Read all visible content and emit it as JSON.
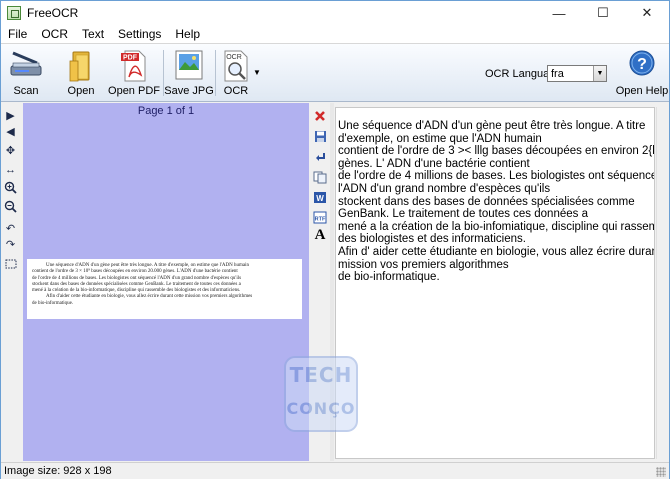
{
  "window": {
    "title": "FreeOCR",
    "controls": {
      "minimize": "—",
      "maximize": "☐",
      "close": "✕"
    }
  },
  "menu": [
    "File",
    "OCR",
    "Text",
    "Settings",
    "Help"
  ],
  "toolbar": {
    "scan_label": "Scan",
    "open_label": "Open",
    "open_pdf_label": "Open PDF",
    "save_jpg_label": "Save JPG",
    "ocr_label": "OCR",
    "ocr_language_label": "OCR Language:",
    "ocr_language_value": "fra",
    "open_help_label": "Open Help"
  },
  "image_panel": {
    "page_indicator": "Page 1 of 1",
    "doc_lines": [
      "Une séquence d'ADN d'un gène peut être très longue. A titre d'exemple, on estime que l'ADN humain",
      "contient de l'ordre de 3 × 10⁹ bases découpées en environ 20.000 gènes. L'ADN d'une bactérie contient",
      "de l'ordre de 4 millions de bases. Les biologistes ont séquencé l'ADN d'un grand nombre d'espèces qu'ils",
      "stockent dans des bases de données spécialisées comme GenBank. Le traitement de toutes ces données a",
      "mené à la création de la bio-informatique, discipline qui rassemble des biologistes et des informaticiens.",
      "Afin d'aider cette étudiante en biologie, vous allez écrire durant cette mission vos premiers algorithmes",
      "de bio-informatique."
    ]
  },
  "text_output": {
    "lines": [
      "Une séquence d'ADN d'un gène peut être très longue. A titre",
      "d'exemple, on estime que l'ADN humain",
      "contient de l'ordre de 3 >< lllg bases découpées en environ 2{l.{l{}{l",
      "gènes. L' ADN d'une bactérie contient",
      "de l'ordre de 4 millions de bases. Les biologistes ont séquence",
      "l'ADN d'un grand nombre d'espèces qu'ils",
      "stockent dans des bases de données spécialisées comme",
      "GenBank. Le traitement de toutes ces données a",
      "mené a la création de la bio-infomiatique, discipline qui rassemble",
      "des biologistes et des informaticiens.",
      "Afin d' aider cette étudiante en biologie, vous allez écrire durant cette",
      "mission vos premiers algorithmes",
      "de bio-informatique."
    ]
  },
  "status": {
    "image_size": "Image size:  928 x  198"
  },
  "watermark": {
    "line1": "TECH",
    "line2": "CONÇO"
  },
  "colors": {
    "image_panel_bg": "#b1b1f0",
    "toolbar_gradient_end": "#dfe8f3",
    "accent_blue": "#2f6fc6",
    "delete_red": "#d12a2a"
  }
}
